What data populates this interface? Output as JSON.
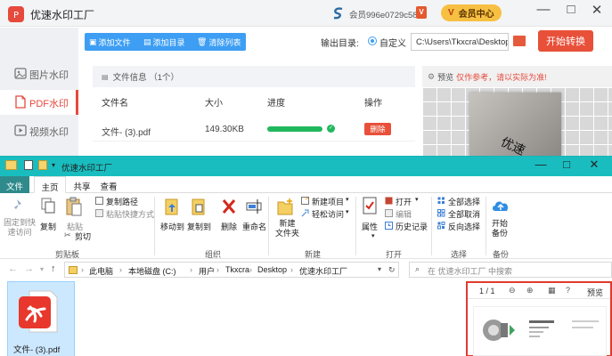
{
  "app": {
    "title": "优速水印工厂",
    "member_id": "会员996e0729c58b",
    "vip_mark": "V",
    "vip_center": "会员中心",
    "window_controls": {
      "minimize": "—",
      "maximize": "□",
      "close": "✕"
    },
    "sidebar": {
      "items": [
        {
          "label": "图片水印",
          "icon": "image-icon",
          "active": false
        },
        {
          "label": "PDF水印",
          "icon": "pdf-icon",
          "active": true
        },
        {
          "label": "视频水印",
          "icon": "video-icon",
          "active": false
        }
      ]
    },
    "toolbar": {
      "add_file": "添加文件",
      "add_dir": "添加目录",
      "clear_list": "清除列表"
    },
    "output": {
      "label": "输出目录:",
      "option": "自定义",
      "path": "C:\\Users\\Tkxcra\\Desktop"
    },
    "start_button": "开始转换",
    "file_panel": {
      "header": "文件信息 （1个）",
      "columns": [
        "文件名",
        "大小",
        "进度",
        "操作"
      ],
      "rows": [
        {
          "name": "文件- (3).pdf",
          "size": "149.30KB",
          "progress": 1.0,
          "action": "删除"
        }
      ]
    },
    "preview": {
      "label": "预览",
      "hint": "仅作参考，请以实际为准!",
      "watermark_text": "优速"
    },
    "colors": {
      "accent": "#e64a3d",
      "toolbar_blue": "#3d9ef3",
      "progress_green": "#21b85d",
      "vip_gold": "#f7c042"
    }
  },
  "explorer": {
    "title": "优速水印工厂",
    "window_controls": {
      "minimize": "—",
      "maximize": "□",
      "close": "✕"
    },
    "tabs": [
      "文件",
      "主页",
      "共享",
      "查看"
    ],
    "ribbon": {
      "clipboard": {
        "pin": "固定到快\n速访问",
        "copy": "复制",
        "paste": "粘贴",
        "copy_path": "复制路径",
        "paste_shortcut": "粘贴快捷方式",
        "cut": "剪切",
        "group": "剪贴板"
      },
      "organize": {
        "move_to": "移动到",
        "copy_to": "复制到",
        "delete": "删除",
        "rename": "重命名",
        "group": "组织"
      },
      "new": {
        "new_folder": "新建\n文件夹",
        "new_item": "新建项目",
        "easy_access": "轻松访问",
        "group": "新建"
      },
      "open": {
        "properties": "属性",
        "open": "打开",
        "edit": "编辑",
        "history": "历史记录",
        "group": "打开"
      },
      "select": {
        "select_all": "全部选择",
        "select_none": "全部取消",
        "invert": "反向选择",
        "group": "选择"
      },
      "backup": {
        "start_backup": "开始\n备份",
        "group": "备份"
      }
    },
    "address": {
      "crumbs": [
        "此电脑",
        "本地磁盘 (C:)",
        "用户",
        "Tkxcra",
        "Desktop",
        "优速水印工厂"
      ],
      "search_placeholder": "在 优速水印工厂 中搜索"
    },
    "files": [
      {
        "name": "文件- (3).pdf"
      }
    ],
    "preview_pane": {
      "page": "1 / 1",
      "preview_label": "预览"
    },
    "colors": {
      "title_teal": "#19bdbf",
      "file_tab": "#2f8a8c",
      "selection": "#cce8ff",
      "preview_border": "#e03a2e"
    }
  }
}
